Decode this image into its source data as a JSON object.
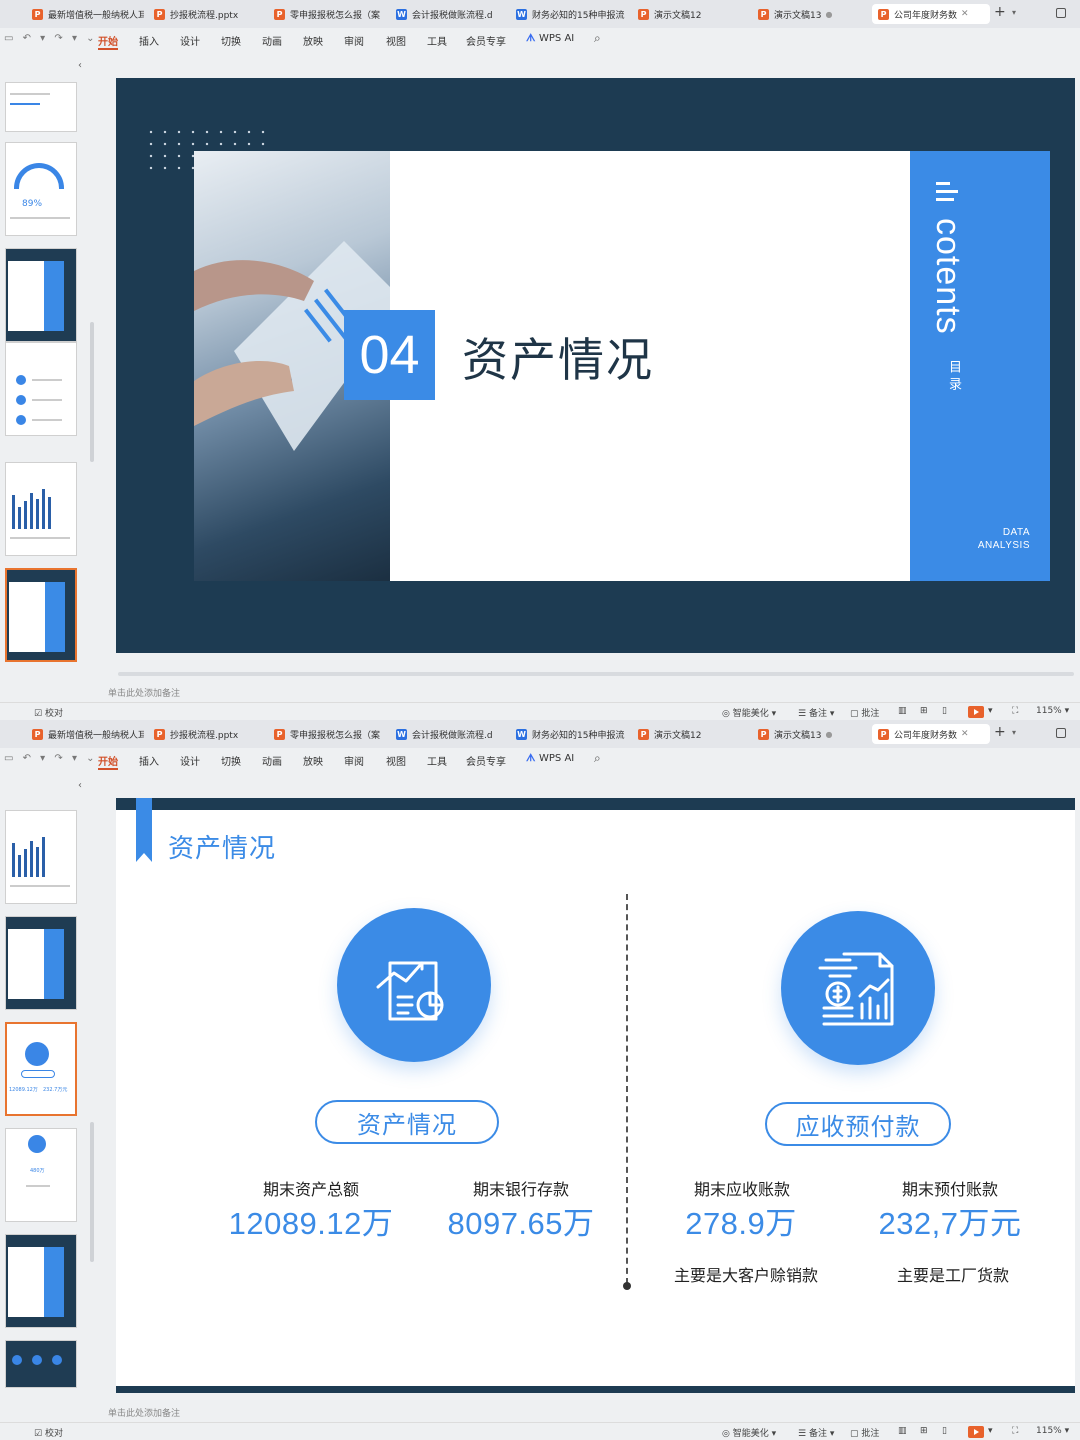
{
  "tabs": [
    {
      "type": "P",
      "label": "最新增值税一般纳税人耳"
    },
    {
      "type": "P",
      "label": "抄报税流程.pptx"
    },
    {
      "type": "P",
      "label": "零申报报税怎么报（案"
    },
    {
      "type": "W",
      "label": "会计报税做账流程.d"
    },
    {
      "type": "W",
      "label": "财务必知的15种申报流"
    },
    {
      "type": "P",
      "label": "演示文稿12"
    },
    {
      "type": "P",
      "label": "演示文稿13"
    },
    {
      "type": "P",
      "label": "公司年度财务数"
    }
  ],
  "menu": [
    "开始",
    "插入",
    "设计",
    "切换",
    "动画",
    "放映",
    "审阅",
    "视图",
    "工具",
    "会员专享",
    "WPS AI"
  ],
  "notes_placeholder": "单击此处添加备注",
  "status": {
    "proofread": "校对",
    "beautify": "智能美化",
    "notes": "备注",
    "comment": "批注",
    "zoom": "115%"
  },
  "thumbs": {
    "gauge_value": "89%",
    "value_a": "12089.12万",
    "value_b": "232.7万元",
    "value_c": "480万"
  },
  "slide1": {
    "number": "04",
    "title": "资产情况",
    "side_title": "cotents",
    "side_sub": "目录",
    "data_line1": "DATA",
    "data_line2": "ANALYSIS"
  },
  "slide2": {
    "title": "资产情况",
    "left": {
      "pill": "资产情况",
      "items": [
        {
          "label": "期末资产总额",
          "value": "12089.12万"
        },
        {
          "label": "期末银行存款",
          "value": "8097.65万"
        }
      ]
    },
    "right": {
      "pill": "应收预付款",
      "items": [
        {
          "label": "期末应收账款",
          "value": "278.9万",
          "note": "主要是大客户赊销款"
        },
        {
          "label": "期末预付账款",
          "value": "232,7万元",
          "note": "主要是工厂货款"
        }
      ]
    }
  },
  "colors": {
    "accent": "#3b8be6",
    "navy": "#1d3b52",
    "menu_active": "#d2512a"
  }
}
